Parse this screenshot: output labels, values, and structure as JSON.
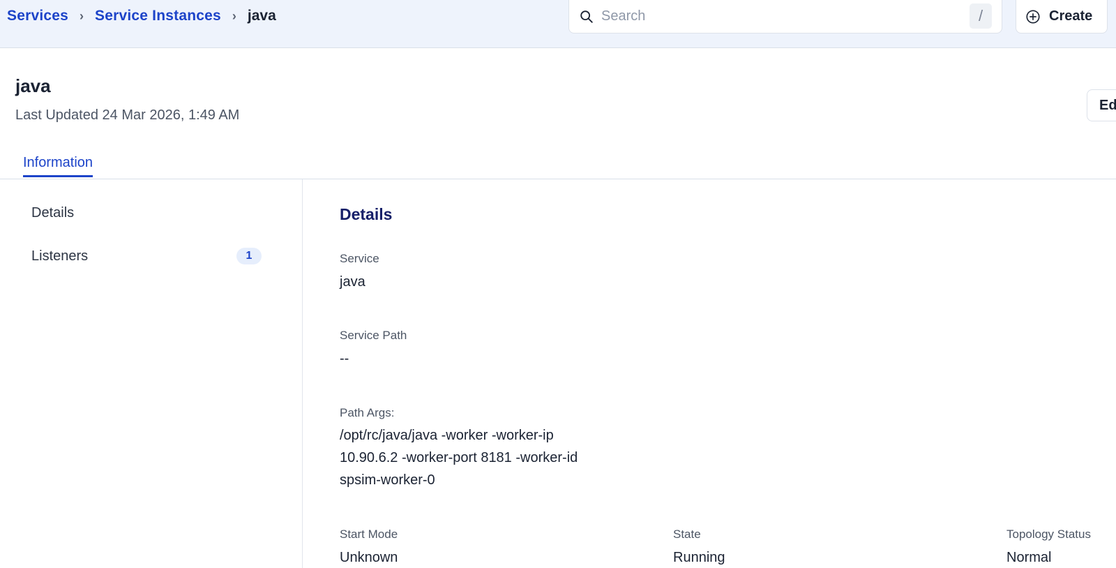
{
  "breadcrumb": {
    "items": [
      "Services",
      "Service Instances"
    ],
    "current": "java"
  },
  "search": {
    "placeholder": "Search",
    "shortcut": "/"
  },
  "create_button": {
    "label": "Create",
    "icon": "plus-circle-icon"
  },
  "header": {
    "title": "java",
    "last_updated": "Last Updated 24 Mar 2026, 1:49 AM",
    "edit_label": "Ed"
  },
  "tabs": [
    {
      "label": "Information",
      "active": true
    }
  ],
  "nav": {
    "items": [
      {
        "label": "Details"
      },
      {
        "label": "Listeners",
        "badge": "1"
      }
    ]
  },
  "details": {
    "title": "Details",
    "service": {
      "label": "Service",
      "value": "java"
    },
    "service_path": {
      "label": "Service Path",
      "value": "--"
    },
    "path_args": {
      "label": "Path Args:",
      "lines": [
        "/opt/rc/java/java -worker -worker-ip",
        "10.90.6.2 -worker-port 8181 -worker-id",
        "spsim-worker-0"
      ]
    },
    "start_mode": {
      "label": "Start Mode",
      "value": "Unknown"
    },
    "state": {
      "label": "State",
      "value": "Running"
    },
    "topology_status": {
      "label": "Topology Status",
      "value": "Normal"
    }
  },
  "colors": {
    "accent": "#1d44c9",
    "topbar_bg": "#eef3fc",
    "section_title": "#172069"
  }
}
